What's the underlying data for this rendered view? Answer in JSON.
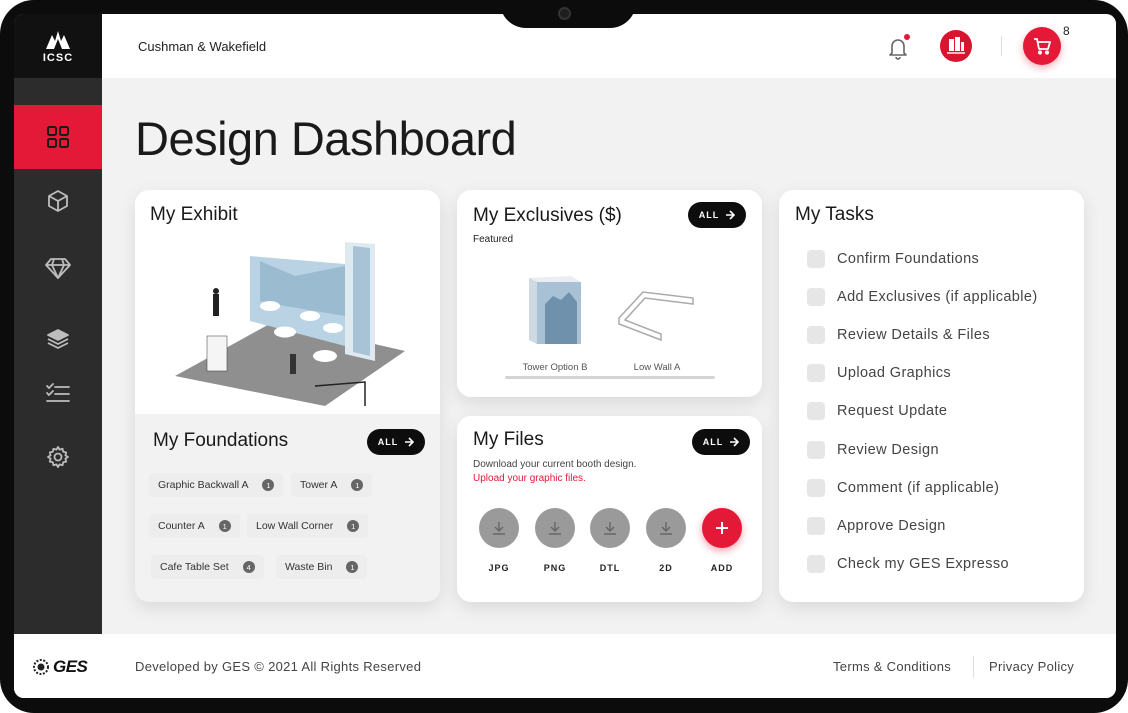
{
  "app": {
    "logo_text": "ICSC",
    "company": "Cushman & Wakefield",
    "cart_count": "8",
    "page_title": "Design Dashboard"
  },
  "sidebar": {
    "items": [
      {
        "name": "dashboard",
        "icon": "grid-icon",
        "active": true
      },
      {
        "name": "exhibit",
        "icon": "cube-icon",
        "active": false
      },
      {
        "name": "exclusives",
        "icon": "diamond-icon",
        "active": false
      },
      {
        "name": "layers",
        "icon": "layers-icon",
        "active": false
      },
      {
        "name": "tasks",
        "icon": "checklist-icon",
        "active": false
      },
      {
        "name": "settings",
        "icon": "gear-icon",
        "active": false
      }
    ]
  },
  "exhibit": {
    "title": "My Exhibit"
  },
  "foundations": {
    "title": "My Foundations",
    "all_label": "ALL",
    "chips": [
      {
        "label": "Graphic Backwall A",
        "count": "1"
      },
      {
        "label": "Tower A",
        "count": "1"
      },
      {
        "label": "Counter A",
        "count": "1"
      },
      {
        "label": "Low Wall Corner",
        "count": "1"
      },
      {
        "label": "Cafe Table Set",
        "count": "4"
      },
      {
        "label": "Waste Bin",
        "count": "1"
      }
    ]
  },
  "exclusives": {
    "title": "My Exclusives ($)",
    "all_label": "ALL",
    "featured_label": "Featured",
    "items": [
      {
        "label": "Tower Option B"
      },
      {
        "label": "Low Wall A"
      }
    ]
  },
  "files": {
    "title": "My Files",
    "all_label": "ALL",
    "description": "Download your current booth design.",
    "upload_link": "Upload your graphic files.",
    "formats": [
      {
        "label": "JPG"
      },
      {
        "label": "PNG"
      },
      {
        "label": "DTL"
      },
      {
        "label": "2D"
      },
      {
        "label": "ADD"
      }
    ]
  },
  "tasks": {
    "title": "My Tasks",
    "items": [
      {
        "label": "Confirm Foundations"
      },
      {
        "label": "Add Exclusives (if applicable)"
      },
      {
        "label": "Review Details & Files"
      },
      {
        "label": "Upload Graphics"
      },
      {
        "label": "Request Update"
      },
      {
        "label": "Review Design"
      },
      {
        "label": "Comment (if applicable)"
      },
      {
        "label": "Approve Design"
      },
      {
        "label": "Check my GES Expresso"
      }
    ]
  },
  "footer": {
    "logo_text": "GES",
    "copyright": "Developed by GES © 2021 All Rights Reserved",
    "terms": "Terms & Conditions",
    "privacy": "Privacy Policy"
  },
  "colors": {
    "accent": "#e31937",
    "sidebar": "#2c2c2c"
  }
}
